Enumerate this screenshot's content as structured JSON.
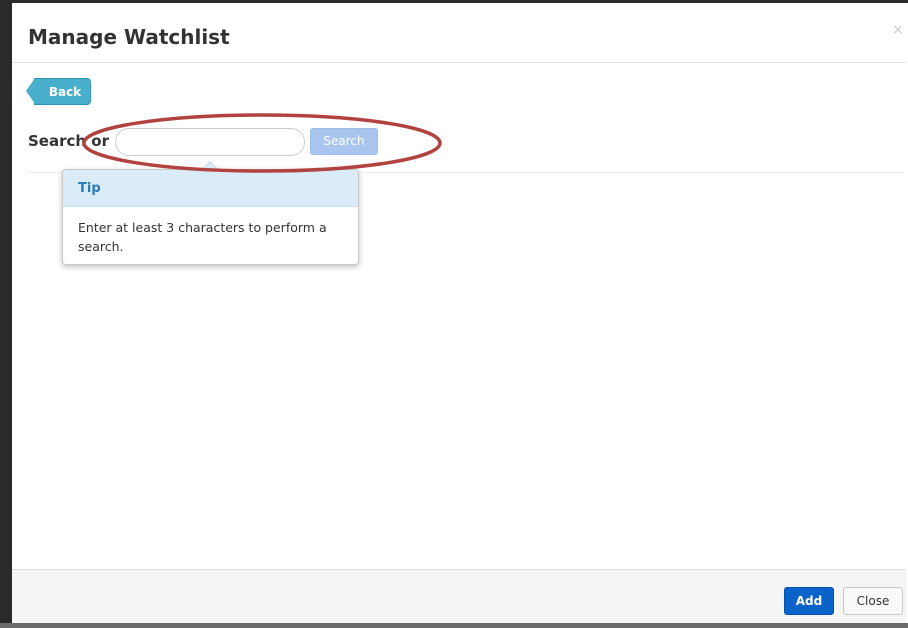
{
  "modal": {
    "title": "Manage Watchlist",
    "close_glyph": "×"
  },
  "toolbar": {
    "back_label": "Back"
  },
  "search": {
    "label": "Search or",
    "input_value": "",
    "placeholder": "",
    "button_label": "Search"
  },
  "tooltip": {
    "title": "Tip",
    "body": "Enter at least 3 characters to perform a search."
  },
  "footer": {
    "add_label": "Add",
    "close_label": "Close"
  },
  "colors": {
    "back_button": "#49afcd",
    "search_button_disabled": "#a9c6ef",
    "add_button": "#0a63c8",
    "annotation_ellipse": "#b0433f",
    "tooltip_header": "#daecf8"
  },
  "annotation": {
    "shape": "ellipse",
    "highlights": "search-bar"
  }
}
